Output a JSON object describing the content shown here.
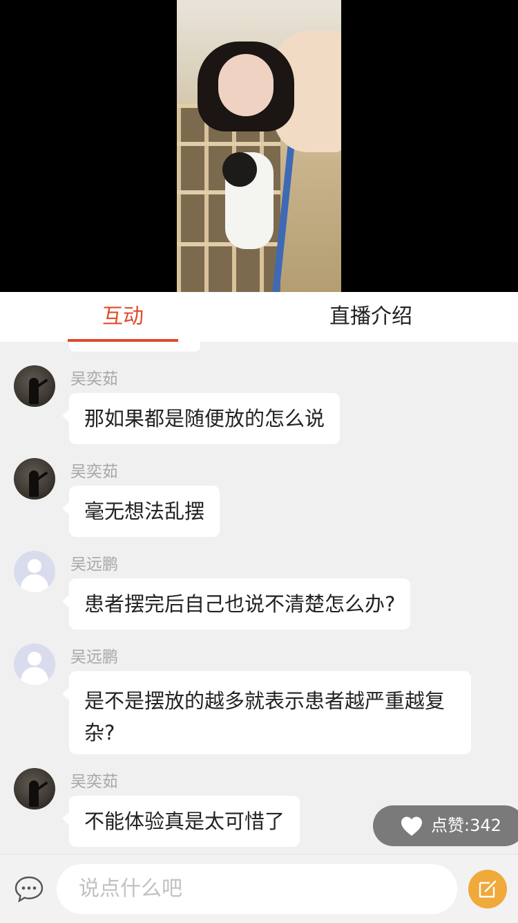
{
  "tabs": {
    "interact": "互动",
    "intro": "直播介绍"
  },
  "messages": [
    {
      "name": "吴奕茹",
      "text": "那如果都是随便放的怎么说",
      "avatar": "photo-avatar"
    },
    {
      "name": "吴奕茹",
      "text": "毫无想法乱摆",
      "avatar": "photo-avatar"
    },
    {
      "name": "吴远鹏",
      "text": "患者摆完后自己也说不清楚怎么办?",
      "avatar": "default-user-avatar"
    },
    {
      "name": "吴远鹏",
      "text": "是不是摆放的越多就表示患者越严重越复杂?",
      "avatar": "default-user-avatar"
    },
    {
      "name": "吴奕茹",
      "text": "不能体验真是太可惜了",
      "avatar": "photo-avatar"
    }
  ],
  "like": {
    "label": "点赞:342",
    "icon": "heart-icon"
  },
  "composer": {
    "placeholder": "说点什么吧",
    "left_icon": "chat-bubble-icon",
    "right_icon": "edit-icon"
  },
  "colors": {
    "accent": "#e04b2a",
    "edit_button": "#f0a93b",
    "like_badge": "#7a7a7a"
  }
}
